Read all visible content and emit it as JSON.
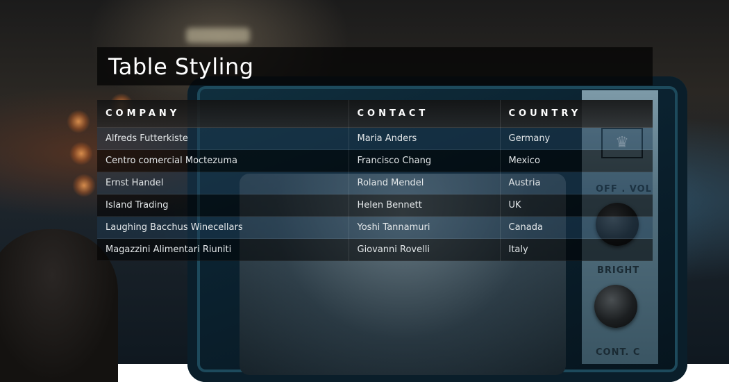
{
  "page": {
    "title": "Table Styling"
  },
  "table": {
    "headers": [
      "COMPANY",
      "CONTACT",
      "COUNTRY"
    ],
    "rows": [
      [
        "Alfreds Futterkiste",
        "Maria Anders",
        "Germany"
      ],
      [
        "Centro comercial Moctezuma",
        "Francisco Chang",
        "Mexico"
      ],
      [
        "Ernst Handel",
        "Roland Mendel",
        "Austria"
      ],
      [
        "Island Trading",
        "Helen Bennett",
        "UK"
      ],
      [
        "Laughing Bacchus Winecellars",
        "Yoshi Tannamuri",
        "Canada"
      ],
      [
        "Magazzini Alimentari Riuniti",
        "Giovanni Rovelli",
        "Italy"
      ]
    ]
  },
  "background": {
    "panel_labels": [
      "OFF . VOL",
      "BRIGHT",
      "CONT. C"
    ],
    "emblem_icon": "crown-icon"
  },
  "colors": {
    "title_bar": "#050505",
    "header_row": "#1a1a1a",
    "row_odd": "#1e3c55",
    "row_even": "#000000",
    "text": "#ffffff"
  }
}
